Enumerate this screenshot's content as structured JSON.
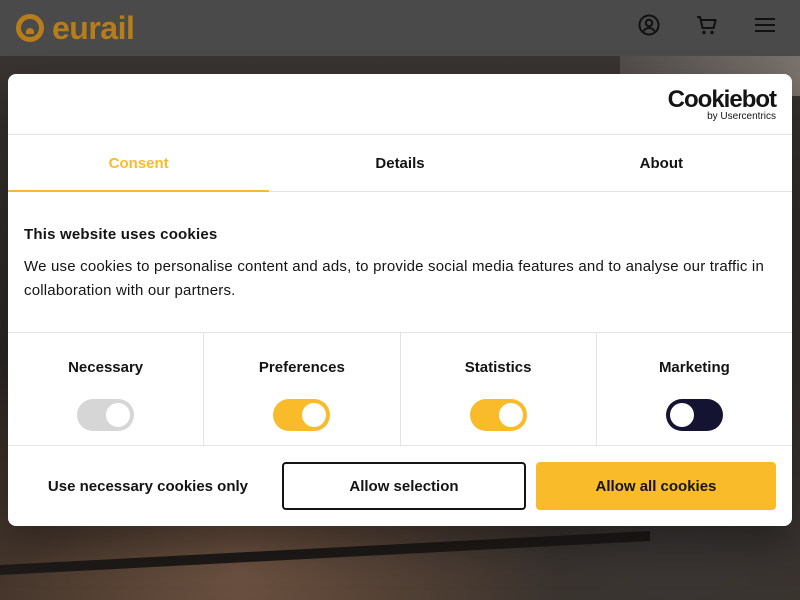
{
  "brand": {
    "name": "eurail",
    "color": "#b67d1a"
  },
  "topbar": {
    "icons": [
      "account-icon",
      "cart-icon",
      "menu-icon"
    ]
  },
  "cookiebot": {
    "name": "Cookiebot",
    "by": "by Usercentrics"
  },
  "tabs": [
    {
      "label": "Consent",
      "active": true
    },
    {
      "label": "Details",
      "active": false
    },
    {
      "label": "About",
      "active": false
    }
  ],
  "consent": {
    "title": "This website uses cookies",
    "text": "We use cookies to personalise content and ads, to provide social media features and to analyse our traffic in collaboration with our partners."
  },
  "categories": [
    {
      "label": "Necessary",
      "enabled": true,
      "locked": true,
      "color": "#d6d6d6"
    },
    {
      "label": "Preferences",
      "enabled": true,
      "locked": false,
      "color": "#f9bb2a"
    },
    {
      "label": "Statistics",
      "enabled": true,
      "locked": false,
      "color": "#f9bb2a"
    },
    {
      "label": "Marketing",
      "enabled": false,
      "locked": false,
      "color": "#141432"
    }
  ],
  "buttons": {
    "necessary": "Use necessary cookies only",
    "selection": "Allow selection",
    "all": "Allow all cookies"
  },
  "colors": {
    "accent": "#f9bb2a",
    "text": "#141414"
  }
}
